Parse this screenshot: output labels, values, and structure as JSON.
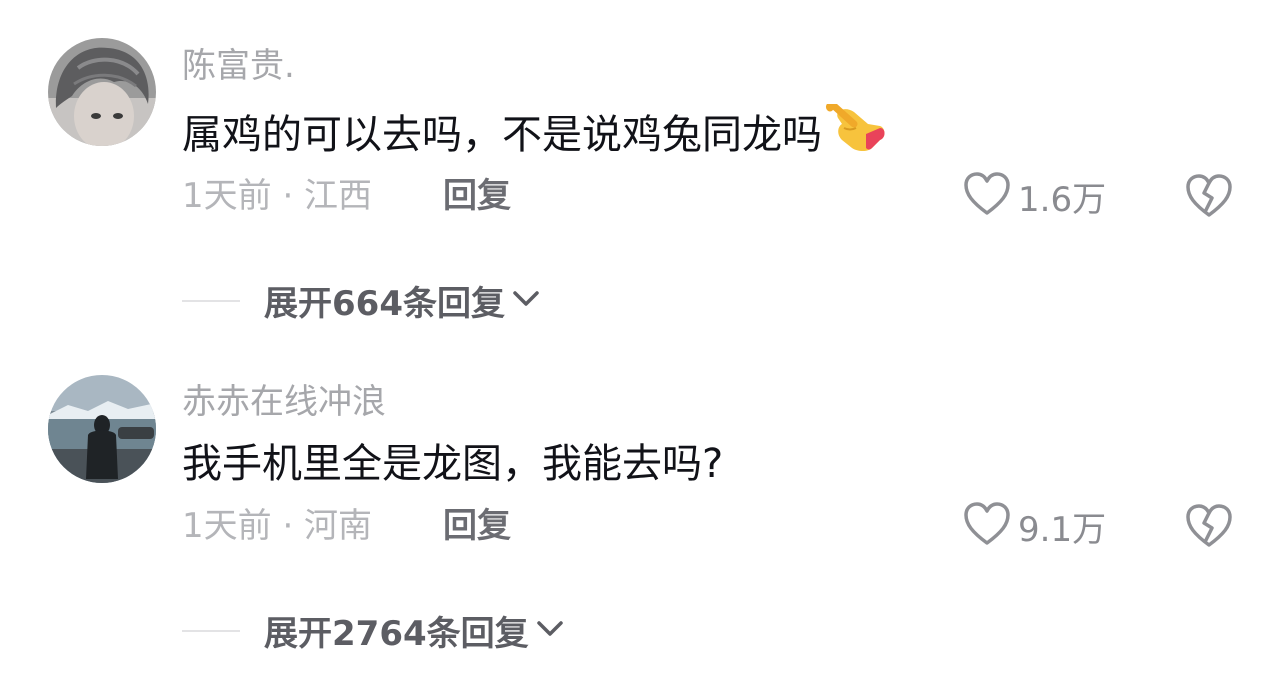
{
  "comments": [
    {
      "username": "陈富贵.",
      "text": "属鸡的可以去吗，不是说鸡兔同龙吗",
      "emoji": "pointing-hand-emoji",
      "meta": "1天前 · 江西",
      "reply_label": "回复",
      "like_count": "1.6万",
      "expand_label": "展开664条回复"
    },
    {
      "username": "赤赤在线冲浪",
      "text": "我手机里全是龙图，我能去吗?",
      "meta": "1天前 · 河南",
      "reply_label": "回复",
      "like_count": "9.1万",
      "expand_label": "展开2764条回复"
    }
  ],
  "icons": {
    "like": "heart-outline-icon",
    "dislike": "broken-heart-icon",
    "expand": "chevron-down-icon"
  },
  "colors": {
    "username": "#a6a7ab",
    "text": "#111218",
    "meta": "#b4b5b9",
    "expand": "#5c5d63"
  }
}
